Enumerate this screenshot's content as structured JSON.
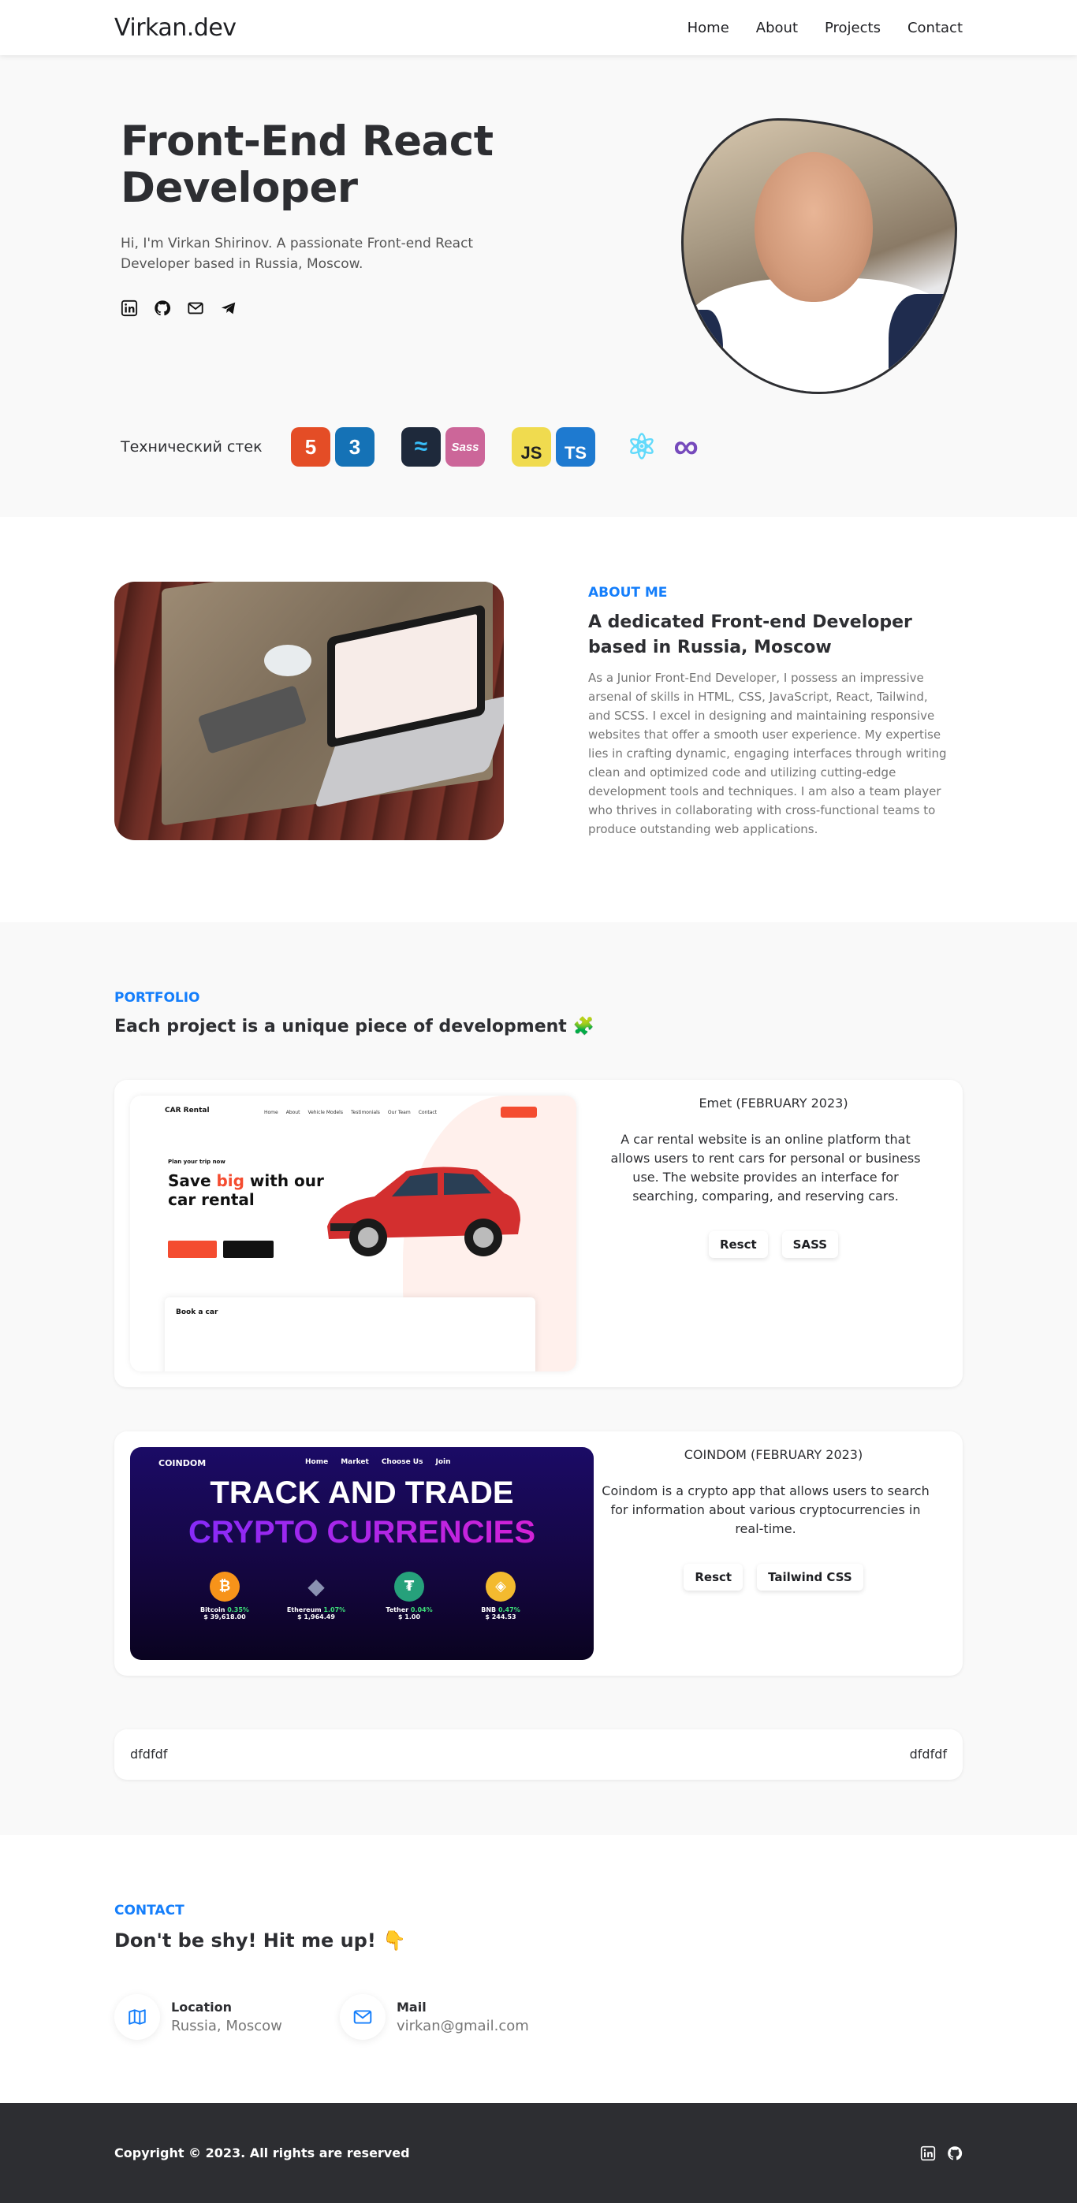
{
  "header": {
    "logo": "Virkan.dev",
    "nav": [
      "Home",
      "About",
      "Projects",
      "Contact"
    ]
  },
  "hero": {
    "title": "Front-End React Developer",
    "subtitle": "Hi, I'm Virkan Shirinov. A passionate Front-end React Developer based in Russia, Moscow.",
    "social_icons": [
      "linkedin-icon",
      "github-icon",
      "mail-icon",
      "telegram-icon"
    ],
    "stack_label": "Технический стек",
    "stack": [
      {
        "icon": "html5-icon",
        "text": "5",
        "color": "#e44d26"
      },
      {
        "icon": "css3-icon",
        "text": "3",
        "color": "#1572b6"
      },
      {
        "icon": "tailwind-icon",
        "text": "≈",
        "color": "#1e293b"
      },
      {
        "icon": "sass-icon",
        "text": "Sass",
        "color": "#cc6699"
      },
      {
        "icon": "javascript-icon",
        "text": "JS",
        "color": "#f0db4f"
      },
      {
        "icon": "typescript-icon",
        "text": "TS",
        "color": "#1e7ad0"
      },
      {
        "icon": "react-icon",
        "text": "⚛",
        "color": "#61dafb"
      },
      {
        "icon": "redux-icon",
        "text": "∞",
        "color": "#764abc"
      }
    ]
  },
  "about": {
    "kicker": "ABOUT ME",
    "heading": "A dedicated Front-end Developer based in Russia, Moscow",
    "text": "As a Junior Front-End Developer, I possess an impressive arsenal of skills in HTML, CSS, JavaScript, React, Tailwind, and SCSS. I excel in designing and maintaining responsive websites that offer a smooth user experience. My expertise lies in crafting dynamic, engaging interfaces through writing clean and optimized code and utilizing cutting-edge development tools and techniques. I am also a team player who thrives in collaborating with cross-functional teams to produce outstanding web applications."
  },
  "portfolio": {
    "kicker": "PORTFOLIO",
    "heading": "Each project is a unique piece of development 🧩",
    "projects": [
      {
        "title": "Emet (FEBRUARY 2023)",
        "description": "A car rental website is an online platform that allows users to rent cars for personal or business use. The website provides an interface for searching, comparing, and reserving cars.",
        "tags": [
          "Resct",
          "SASS"
        ],
        "shot": {
          "brand": "CAR Rental",
          "links": [
            "Home",
            "About",
            "Vehicle Models",
            "Testimonials",
            "Our Team",
            "Contact"
          ],
          "small": "Plan your trip now",
          "heading_a": "Save ",
          "heading_b": "big",
          "heading_c": " with our car rental",
          "book": "Book a car"
        }
      },
      {
        "title": "COINDOM (FEBRUARY 2023)",
        "description": "Coindom is a crypto app that allows users to search for information about various cryptocurrencies in real-time.",
        "tags": [
          "Resct",
          "Tailwind CSS"
        ],
        "shot": {
          "brand": "COINDOM",
          "links": [
            "Home",
            "Market",
            "Choose Us",
            "Join"
          ],
          "line1": "TRACK AND TRADE",
          "line2": "CRYPTO CURRENCIES",
          "coins": [
            {
              "name": "Bitcoin",
              "change": "0.35%",
              "price": "$ 39,618.00",
              "color": "#f7931a",
              "sym": "₿"
            },
            {
              "name": "Ethereum",
              "change": "1.07%",
              "price": "$ 1,964.49",
              "color": "#627eea",
              "sym": "◆"
            },
            {
              "name": "Tether",
              "change": "0.04%",
              "price": "$ 1.00",
              "color": "#26a17b",
              "sym": "₮"
            },
            {
              "name": "BNB",
              "change": "0.47%",
              "price": "$ 244.53",
              "color": "#f3ba2f",
              "sym": "◈"
            }
          ]
        }
      }
    ],
    "extra_left": "dfdfdf",
    "extra_right": "dfdfdf"
  },
  "contact": {
    "kicker": "CONTACT",
    "heading": "Don't be shy! Hit me up! 👇",
    "items": [
      {
        "label": "Location",
        "value": "Russia, Moscow",
        "icon": "map-icon"
      },
      {
        "label": "Mail",
        "value": "virkan@gmail.com",
        "icon": "mail-icon"
      }
    ]
  },
  "footer": {
    "copyright": "Copyright © 2023. All rights are reserved",
    "icons": [
      "linkedin-icon",
      "github-icon"
    ]
  },
  "colors": {
    "accent": "#147efb",
    "dark": "#2d2e32",
    "bg_light": "#f9f9f9"
  }
}
